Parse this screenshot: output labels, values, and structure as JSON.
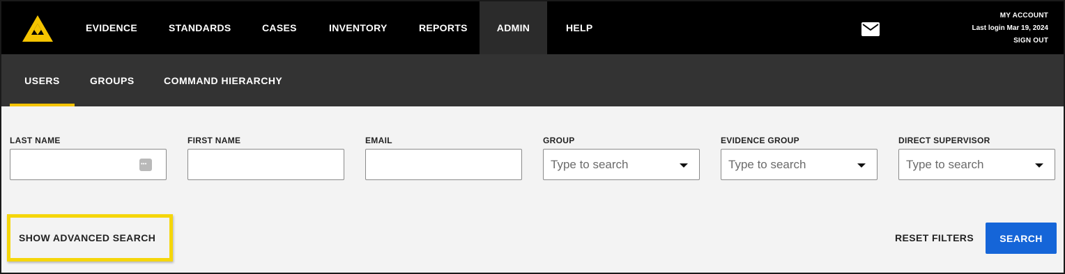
{
  "nav": {
    "items": [
      {
        "label": "EVIDENCE"
      },
      {
        "label": "STANDARDS"
      },
      {
        "label": "CASES"
      },
      {
        "label": "INVENTORY"
      },
      {
        "label": "REPORTS"
      },
      {
        "label": "ADMIN",
        "active": true
      },
      {
        "label": "HELP"
      }
    ]
  },
  "account": {
    "my_account": "MY ACCOUNT",
    "last_login": "Last login Mar 19, 2024",
    "sign_out": "SIGN OUT"
  },
  "subnav": {
    "items": [
      {
        "label": "USERS",
        "active": true
      },
      {
        "label": "GROUPS"
      },
      {
        "label": "COMMAND HIERARCHY"
      }
    ]
  },
  "filters": {
    "last_name": {
      "label": "LAST NAME",
      "value": ""
    },
    "first_name": {
      "label": "FIRST NAME",
      "value": ""
    },
    "email": {
      "label": "EMAIL",
      "value": ""
    },
    "group": {
      "label": "GROUP",
      "placeholder": "Type to search"
    },
    "evidence_group": {
      "label": "EVIDENCE GROUP",
      "placeholder": "Type to search"
    },
    "direct_supervisor": {
      "label": "DIRECT SUPERVISOR",
      "placeholder": "Type to search"
    }
  },
  "actions": {
    "show_advanced": "SHOW ADVANCED SEARCH",
    "reset_filters": "RESET FILTERS",
    "search": "SEARCH"
  },
  "colors": {
    "accent": "#f5c400",
    "primary_button": "#1565d8",
    "topbar": "#000000",
    "subbar": "#333333"
  },
  "icons": {
    "logo": "app-logo",
    "mail": "mail-icon",
    "password": "password-dots-icon",
    "dropdown": "caret-down-icon"
  }
}
